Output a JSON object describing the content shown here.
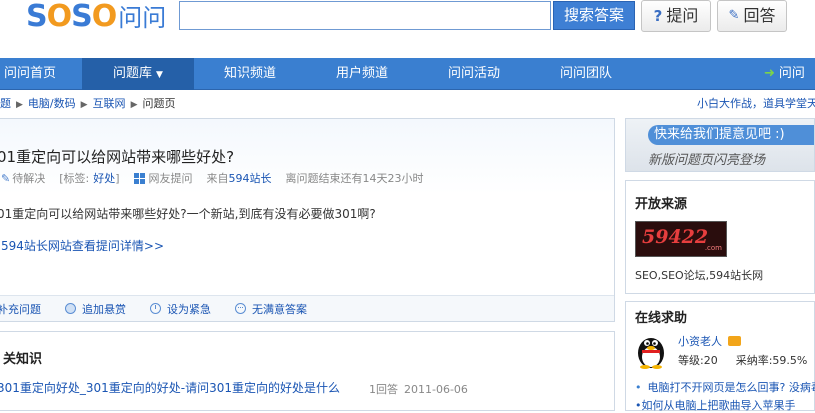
{
  "header": {
    "logo_soso": "SOSO",
    "logo_wenwen": "问问",
    "search_value": "",
    "search_button": "搜索答案",
    "ask_button": "提问",
    "answer_button": "回答"
  },
  "nav": {
    "items": [
      "问问首页",
      "问题库",
      "知识频道",
      "用户频道",
      "问问活动",
      "问问团队",
      "问问"
    ],
    "dropdown_caret": "▼"
  },
  "breadcrumb": {
    "items": [
      "题",
      "电脑/数码",
      "互联网",
      "问题页"
    ],
    "top_right": "小白大作战，道具学堂天"
  },
  "question": {
    "title": "01重定向可以给网站带来哪些好处?",
    "status": "待解决",
    "tags_label": "[标签:",
    "tag": "好处",
    "tags_close": "]",
    "source": "网友提问",
    "from_label": "来自",
    "from_site": "594站长",
    "time_left": "离问题结束还有14天23小时",
    "body": "01重定向可以给网站带来哪些好处?一个新站,到底有没有必要做301啊?",
    "detail_link": "594站长网站查看提问详情>>",
    "actions": [
      "补充问题",
      "追加悬赏",
      "设为紧急",
      "无满意答案"
    ]
  },
  "related": {
    "title": "关知识",
    "item_title": "301重定向好处_301重定向的好处-请问301重定向的好处是什么",
    "item_answers": "1回答",
    "item_date": "2011-06-06"
  },
  "sidebar": {
    "promo_top": "快来给我们提意见吧 :)",
    "promo_sub": "新版问题页闪亮登场",
    "source_heading": "开放来源",
    "source_logo_num": "59422",
    "source_logo_domain": ".com",
    "source_caption": "SEO,SEO论坛,594站长网",
    "help_heading": "在线求助",
    "helper_name": "小资老人",
    "helper_level": "等级:20",
    "helper_rate": "采纳率:59.5%",
    "help_q1": "电脑打不开网页是怎么回事? 没病毒",
    "help_q2": "如何从电脑上把歌曲导入苹果手"
  },
  "colors": {
    "nav_bg": "#3a7fd0",
    "nav_active": "#2560a8",
    "link": "#1a55b3",
    "logo_blue": "#3a7bd5",
    "logo_orange": "#f29a1f"
  }
}
